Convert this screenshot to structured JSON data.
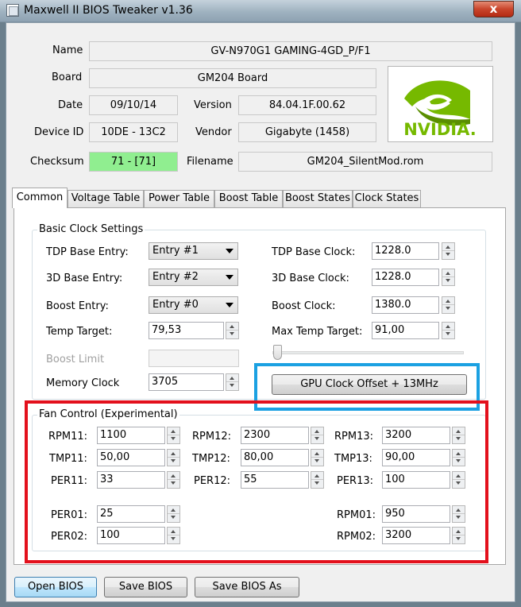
{
  "window": {
    "title": "Maxwell II BIOS Tweaker v1.36",
    "close_glyph": "x"
  },
  "info": {
    "name_label": "Name",
    "name_value": "GV-N970G1 GAMING-4GD_P/F1",
    "board_label": "Board",
    "board_value": "GM204 Board",
    "date_label": "Date",
    "date_value": "09/10/14",
    "version_label": "Version",
    "version_value": "84.04.1F.00.62",
    "device_id_label": "Device ID",
    "device_id_value": "10DE - 13C2",
    "vendor_label": "Vendor",
    "vendor_value": "Gigabyte (1458)",
    "checksum_label": "Checksum",
    "checksum_value": "71 - [71]",
    "checksum_color": "#90EE90",
    "filename_label": "Filename",
    "filename_value": "GM204_SilentMod.rom",
    "logo_text": "NVIDIA.",
    "logo_color": "#76B900"
  },
  "tabs": [
    {
      "label": "Common"
    },
    {
      "label": "Voltage Table"
    },
    {
      "label": "Power Table"
    },
    {
      "label": "Boost Table"
    },
    {
      "label": "Boost States"
    },
    {
      "label": "Clock States"
    }
  ],
  "basic_clock": {
    "group_title": "Basic Clock Settings",
    "tdp_base_entry_label": "TDP Base Entry:",
    "tdp_base_entry_value": "Entry #1",
    "base_3d_entry_label": "3D Base Entry:",
    "base_3d_entry_value": "Entry #2",
    "boost_entry_label": "Boost Entry:",
    "boost_entry_value": "Entry #0",
    "temp_target_label": "Temp Target:",
    "temp_target_value": "79,53",
    "boost_limit_label": "Boost Limit",
    "boost_limit_value": "",
    "memory_clock_label": "Memory Clock",
    "memory_clock_value": "3705",
    "tdp_base_clock_label": "TDP Base Clock:",
    "tdp_base_clock_value": "1228.0",
    "base_3d_clock_label": "3D Base Clock:",
    "base_3d_clock_value": "1228.0",
    "boost_clock_label": "Boost Clock:",
    "boost_clock_value": "1380.0",
    "max_temp_target_label": "Max Temp Target:",
    "max_temp_target_value": "91,00",
    "gpu_offset_slider_level": 0,
    "gpu_offset_button": "GPU Clock Offset + 13MHz"
  },
  "fan_control": {
    "group_title": "Fan Control (Experimental)",
    "rpm11_label": "RPM11:",
    "rpm11_value": "1100",
    "rpm12_label": "RPM12:",
    "rpm12_value": "2300",
    "rpm13_label": "RPM13:",
    "rpm13_value": "3200",
    "tmp11_label": "TMP11:",
    "tmp11_value": "50,00",
    "tmp12_label": "TMP12:",
    "tmp12_value": "80,00",
    "tmp13_label": "TMP13:",
    "tmp13_value": "90,00",
    "per11_label": "PER11:",
    "per11_value": "33",
    "per12_label": "PER12:",
    "per12_value": "55",
    "per13_label": "PER13:",
    "per13_value": "100",
    "per01_label": "PER01:",
    "per01_value": "25",
    "per02_label": "PER02:",
    "per02_value": "100",
    "rpm01_label": "RPM01:",
    "rpm01_value": "950",
    "rpm02_label": "RPM02:",
    "rpm02_value": "3200"
  },
  "buttons": {
    "open_bios": "Open BIOS",
    "save_bios": "Save BIOS",
    "save_bios_as": "Save BIOS As"
  },
  "annotations": {
    "blue_box_color": "#1BA1E2",
    "red_box_color": "#E3101C"
  }
}
